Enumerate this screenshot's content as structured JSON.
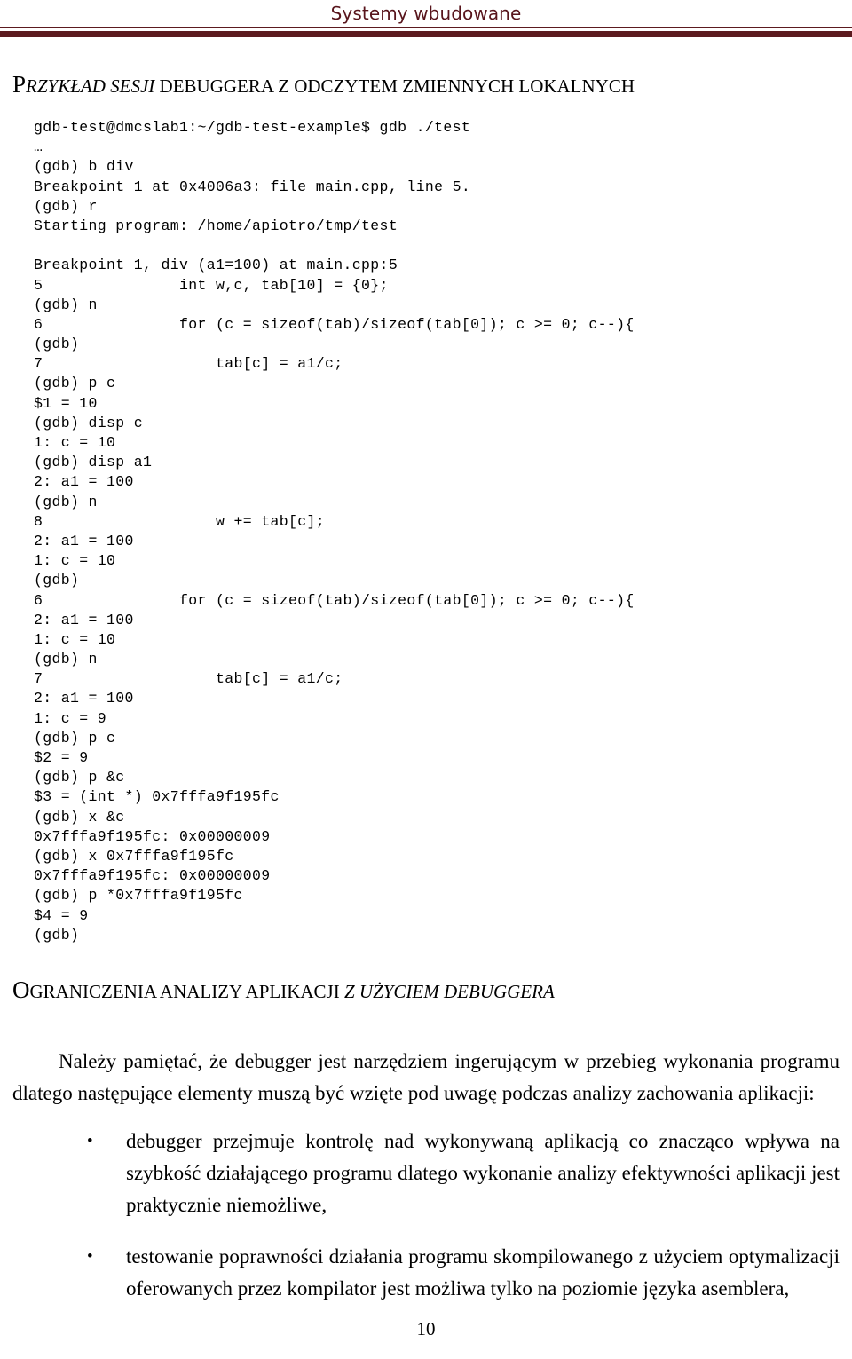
{
  "header": {
    "title": "Systemy wbudowane",
    "rule_color": "#5c1a1f",
    "title_color": "#58151c"
  },
  "headings": {
    "example_session": {
      "lead_letter": "P",
      "italic_part": "RZYKŁAD SESJI",
      "upright_part": " DEBUGGERA Z ODCZYTEM ZMIENNYCH LOKALNYCH"
    },
    "limitations": {
      "lead_letter": "O",
      "upright_part": "GRANICZENIA ANALIZY APLIKACJI ",
      "italic_part": "Z UŻYCIEM DEBUGGERA"
    }
  },
  "terminal": {
    "lines": [
      "gdb-test@dmcslab1:~/gdb-test-example$ gdb ./test",
      "…",
      "(gdb) b div",
      "Breakpoint 1 at 0x4006a3: file main.cpp, line 5.",
      "(gdb) r",
      "Starting program: /home/apiotro/tmp/test",
      "",
      "Breakpoint 1, div (a1=100) at main.cpp:5",
      "5               int w,c, tab[10] = {0};",
      "(gdb) n",
      "6               for (c = sizeof(tab)/sizeof(tab[0]); c >= 0; c--){",
      "(gdb)",
      "7                   tab[c] = a1/c;",
      "(gdb) p c",
      "$1 = 10",
      "(gdb) disp c",
      "1: c = 10",
      "(gdb) disp a1",
      "2: a1 = 100",
      "(gdb) n",
      "8                   w += tab[c];",
      "2: a1 = 100",
      "1: c = 10",
      "(gdb)",
      "6               for (c = sizeof(tab)/sizeof(tab[0]); c >= 0; c--){",
      "2: a1 = 100",
      "1: c = 10",
      "(gdb) n",
      "7                   tab[c] = a1/c;",
      "2: a1 = 100",
      "1: c = 9",
      "(gdb) p c",
      "$2 = 9",
      "(gdb) p &c",
      "$3 = (int *) 0x7fffa9f195fc",
      "(gdb) x &c",
      "0x7fffa9f195fc: 0x00000009",
      "(gdb) x 0x7fffa9f195fc",
      "0x7fffa9f195fc: 0x00000009",
      "(gdb) p *0x7fffa9f195fc",
      "$4 = 9",
      "(gdb)"
    ]
  },
  "body": {
    "intro_paragraph": "Należy pamiętać, że debugger jest narzędziem ingerującym w przebieg wykonania programu dlatego następujące elementy muszą być wzięte pod uwagę podczas analizy zachowania aplikacji:",
    "bullet_marker": "•",
    "bullets": [
      "debugger przejmuje kontrolę nad wykonywaną aplikacją co znacząco wpływa na szybkość działającego programu dlatego wykonanie analizy efektywności aplikacji jest praktycznie niemożliwe,",
      "testowanie poprawności działania programu skompilowanego z użyciem optymalizacji oferowanych przez kompilator jest możliwa tylko na poziomie języka asemblera,"
    ]
  },
  "footer": {
    "page_number": "10"
  }
}
